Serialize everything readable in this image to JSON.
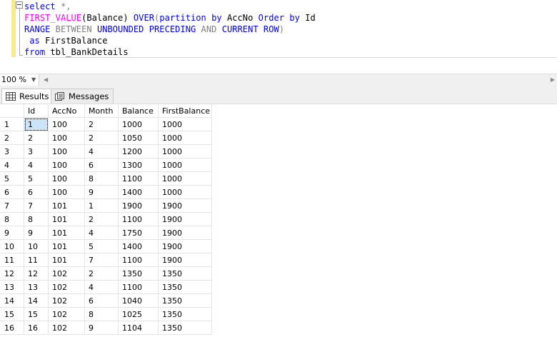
{
  "editor": {
    "lines": [
      {
        "parts": [
          [
            "kw",
            "select"
          ],
          [
            "gray",
            " *,"
          ]
        ]
      },
      {
        "parts": [
          [
            "fn",
            "FIRST_VALUE"
          ],
          [
            "",
            "(Balance) "
          ],
          [
            "kw",
            "OVER"
          ],
          [
            "gray",
            "("
          ],
          [
            "kw",
            "partition by"
          ],
          [
            "",
            " AccNo "
          ],
          [
            "kw",
            "Order by"
          ],
          [
            "",
            " Id"
          ]
        ]
      },
      {
        "parts": [
          [
            "kw",
            "RANGE"
          ],
          [
            "gray",
            " BETWEEN "
          ],
          [
            "kw",
            "UNBOUNDED PRECEDING"
          ],
          [
            "gray",
            " AND "
          ],
          [
            "kw",
            "CURRENT ROW"
          ],
          [
            "gray",
            ")"
          ]
        ]
      },
      {
        "parts": [
          [
            "",
            " "
          ],
          [
            "kw",
            "as"
          ],
          [
            "",
            " FirstBalance"
          ]
        ]
      },
      {
        "parts": [
          [
            "kw",
            "from"
          ],
          [
            "",
            " tbl_BankDetails"
          ]
        ]
      }
    ]
  },
  "status": {
    "zoom": "100 %"
  },
  "tabs": {
    "results": "Results",
    "messages": "Messages"
  },
  "grid": {
    "columns": [
      "Id",
      "AccNo",
      "Month",
      "Balance",
      "FirstBalance"
    ],
    "rows": [
      [
        "1",
        "1",
        "100",
        "2",
        "1000",
        "1000"
      ],
      [
        "2",
        "2",
        "100",
        "2",
        "1050",
        "1000"
      ],
      [
        "3",
        "3",
        "100",
        "4",
        "1200",
        "1000"
      ],
      [
        "4",
        "4",
        "100",
        "6",
        "1300",
        "1000"
      ],
      [
        "5",
        "5",
        "100",
        "8",
        "1100",
        "1000"
      ],
      [
        "6",
        "6",
        "100",
        "9",
        "1400",
        "1000"
      ],
      [
        "7",
        "7",
        "101",
        "1",
        "1900",
        "1900"
      ],
      [
        "8",
        "8",
        "101",
        "2",
        "1100",
        "1900"
      ],
      [
        "9",
        "9",
        "101",
        "4",
        "1750",
        "1900"
      ],
      [
        "10",
        "10",
        "101",
        "5",
        "1400",
        "1900"
      ],
      [
        "11",
        "11",
        "101",
        "7",
        "1100",
        "1900"
      ],
      [
        "12",
        "12",
        "102",
        "2",
        "1350",
        "1350"
      ],
      [
        "13",
        "13",
        "102",
        "4",
        "1100",
        "1350"
      ],
      [
        "14",
        "14",
        "102",
        "6",
        "1040",
        "1350"
      ],
      [
        "15",
        "15",
        "102",
        "8",
        "1025",
        "1350"
      ],
      [
        "16",
        "16",
        "102",
        "9",
        "1104",
        "1350"
      ]
    ]
  }
}
